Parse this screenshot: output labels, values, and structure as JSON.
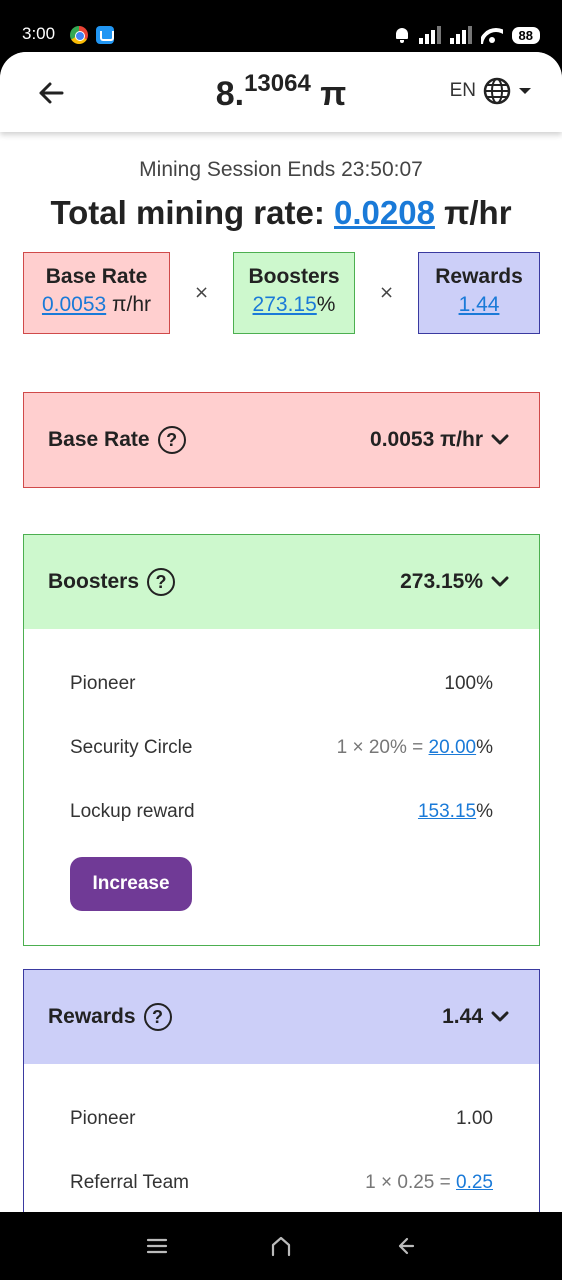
{
  "status_bar": {
    "time": "3:00",
    "battery": "88"
  },
  "header": {
    "balance_int": "8.",
    "balance_frac": "13064",
    "currency": "π",
    "language": "EN"
  },
  "summary": {
    "session_label": "Mining Session Ends 23:50:07",
    "total_label": "Total mining rate: ",
    "total_value": "0.0208",
    "total_unit": " π/hr",
    "multiply_sign": "×",
    "base_rate": {
      "label": "Base Rate",
      "value": "0.0053",
      "unit": " π/hr"
    },
    "boosters": {
      "label": "Boosters",
      "value": "273.15",
      "unit": "%"
    },
    "rewards": {
      "label": "Rewards",
      "value": "1.44"
    }
  },
  "base_rate_card": {
    "title": "Base Rate",
    "value": "0.0053 π/hr"
  },
  "boosters_card": {
    "title": "Boosters",
    "value": "273.15%",
    "rows": [
      {
        "label": "Pioneer",
        "value": "100%"
      },
      {
        "label": "Security Circle",
        "calc": "1 × 20% = ",
        "link": "20.00",
        "suffix": "%"
      },
      {
        "label": "Lockup reward",
        "link": "153.15",
        "suffix": "%"
      }
    ],
    "increase_label": "Increase"
  },
  "rewards_card": {
    "title": "Rewards",
    "value": "1.44",
    "rows": [
      {
        "label": "Pioneer",
        "value": "1.00"
      },
      {
        "label": "Referral Team",
        "calc": "1 × 0.25 = ",
        "link": "0.25"
      }
    ]
  },
  "colors": {
    "red_bg": "#ffcfcf",
    "green_bg": "#cdf8cd",
    "blue_bg": "#cccff8",
    "link": "#1a7ad8",
    "button": "#703a96"
  }
}
